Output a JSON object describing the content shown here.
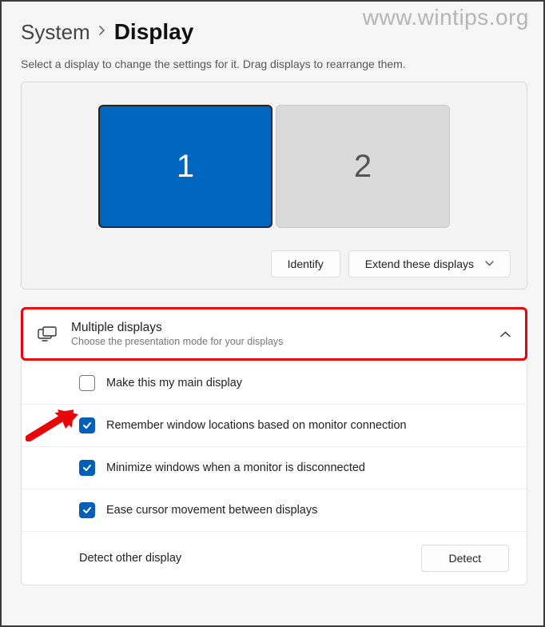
{
  "watermark": "www.wintips.org",
  "breadcrumb": {
    "parent": "System",
    "current": "Display"
  },
  "hint": "Select a display to change the settings for it. Drag displays to rearrange them.",
  "monitors": {
    "m1": "1",
    "m2": "2"
  },
  "actions": {
    "identify": "Identify",
    "extend": "Extend these displays"
  },
  "section": {
    "title": "Multiple displays",
    "subtitle": "Choose the presentation mode for your displays"
  },
  "options": {
    "main": "Make this my main display",
    "remember": "Remember window locations based on monitor connection",
    "minimize": "Minimize windows when a monitor is disconnected",
    "cursor": "Ease cursor movement between displays",
    "detect_label": "Detect other display",
    "detect_btn": "Detect"
  }
}
